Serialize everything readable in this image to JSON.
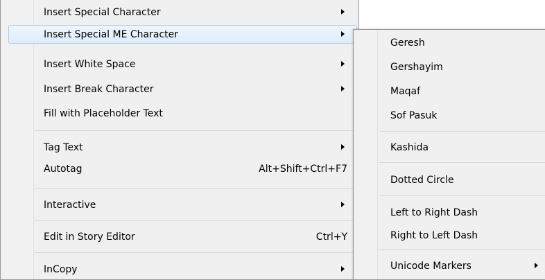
{
  "main_menu": {
    "items": [
      {
        "label": "Insert Special Character",
        "has_submenu": true
      },
      {
        "label": "Insert Special ME Character",
        "has_submenu": true,
        "highlighted": true
      },
      {
        "label": "Insert White Space",
        "has_submenu": true
      },
      {
        "label": "Insert Break Character",
        "has_submenu": true
      },
      {
        "label": "Fill with Placeholder Text"
      },
      {
        "label": "Tag Text",
        "has_submenu": true
      },
      {
        "label": "Autotag",
        "shortcut": "Alt+Shift+Ctrl+F7"
      },
      {
        "label": "Interactive",
        "has_submenu": true
      },
      {
        "label": "Edit in Story Editor",
        "shortcut": "Ctrl+Y"
      },
      {
        "label": "InCopy",
        "has_submenu": true
      }
    ]
  },
  "sub_menu": {
    "items": [
      {
        "label": "Geresh"
      },
      {
        "label": "Gershayim"
      },
      {
        "label": "Maqaf"
      },
      {
        "label": "Sof Pasuk"
      },
      {
        "label": "Kashida"
      },
      {
        "label": "Dotted Circle"
      },
      {
        "label": "Left to Right Dash"
      },
      {
        "label": "Right to Left Dash"
      },
      {
        "label": "Unicode Markers",
        "has_submenu": true
      }
    ]
  },
  "colors": {
    "menu_background": "#f0f0f0",
    "highlight_border": "#a6c9f2",
    "highlight_fill": "#dfecfb",
    "separator": "#d7d7d7"
  }
}
